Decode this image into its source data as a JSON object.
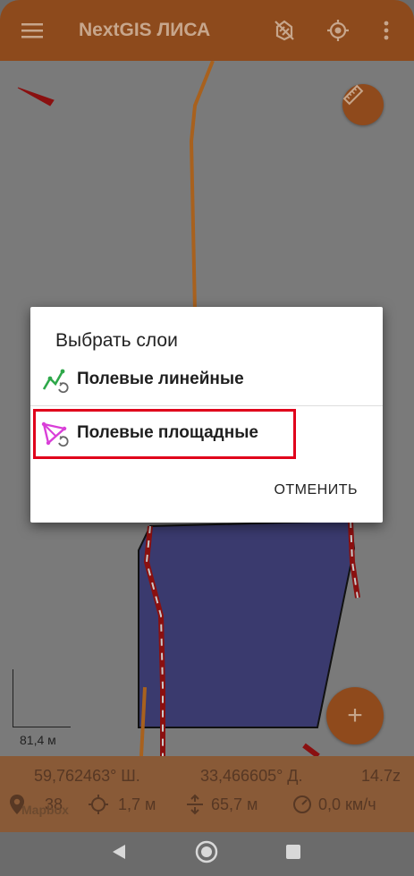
{
  "app": {
    "title": "NextGIS ЛИСА"
  },
  "toolbar": {
    "menu_icon": "menu-icon",
    "no_gps_icon": "gps-off-icon",
    "locate_icon": "crosshair-icon",
    "more_icon": "more-vert-icon"
  },
  "map": {
    "scale_label": "81,4 м",
    "add_fab_label": "+"
  },
  "status": {
    "latitude": "59,762463° Ш.",
    "longitude": "33,466605° Д.",
    "zoom": "14.7z",
    "satellites": "38",
    "accuracy": "1,7 м",
    "altitude": "65,7 м",
    "speed": "0,0 км/ч",
    "watermark": "Mapbox"
  },
  "dialog": {
    "title": "Выбрать слои",
    "items": [
      {
        "label": "Полевые линейные",
        "icon": "line-layer-icon"
      },
      {
        "label": "Полевые площадные",
        "icon": "polygon-layer-icon"
      }
    ],
    "cancel_label": "ОТМЕНИТЬ"
  },
  "colors": {
    "appbar": "#8d4a1c",
    "accent": "#e8742a",
    "highlight": "#e0001b",
    "polygon": "#3a3a6e"
  }
}
